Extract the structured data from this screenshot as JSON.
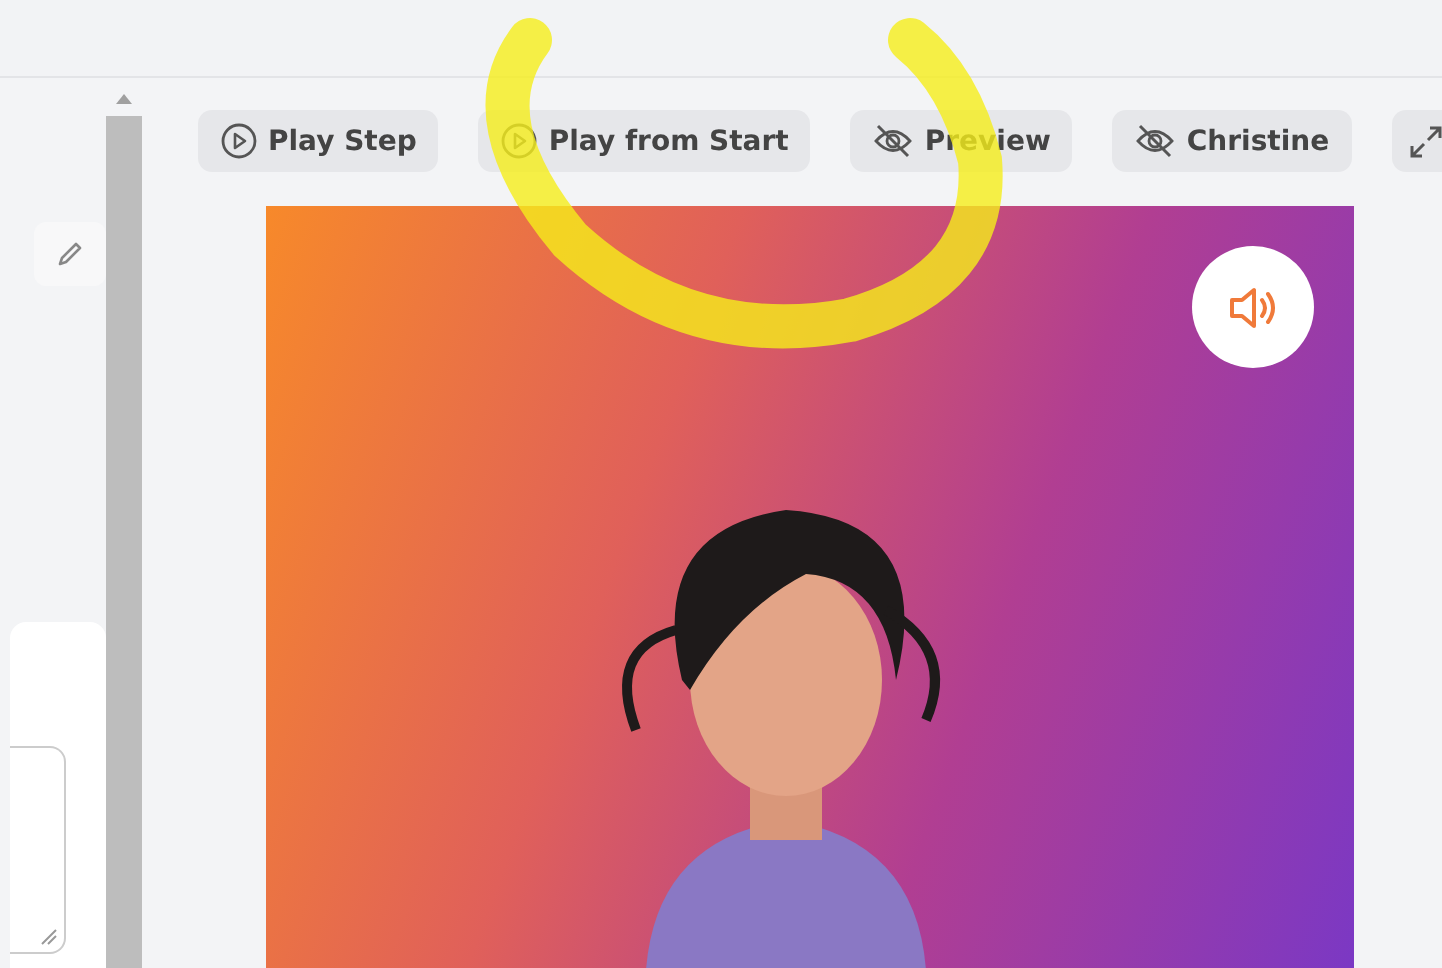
{
  "toolbar": [
    {
      "kind": "play",
      "label": "Play Step"
    },
    {
      "kind": "play",
      "label": "Play from Start"
    },
    {
      "kind": "hidden",
      "label": "Preview"
    },
    {
      "kind": "hidden",
      "label": "Christine"
    },
    {
      "kind": "expand"
    }
  ]
}
